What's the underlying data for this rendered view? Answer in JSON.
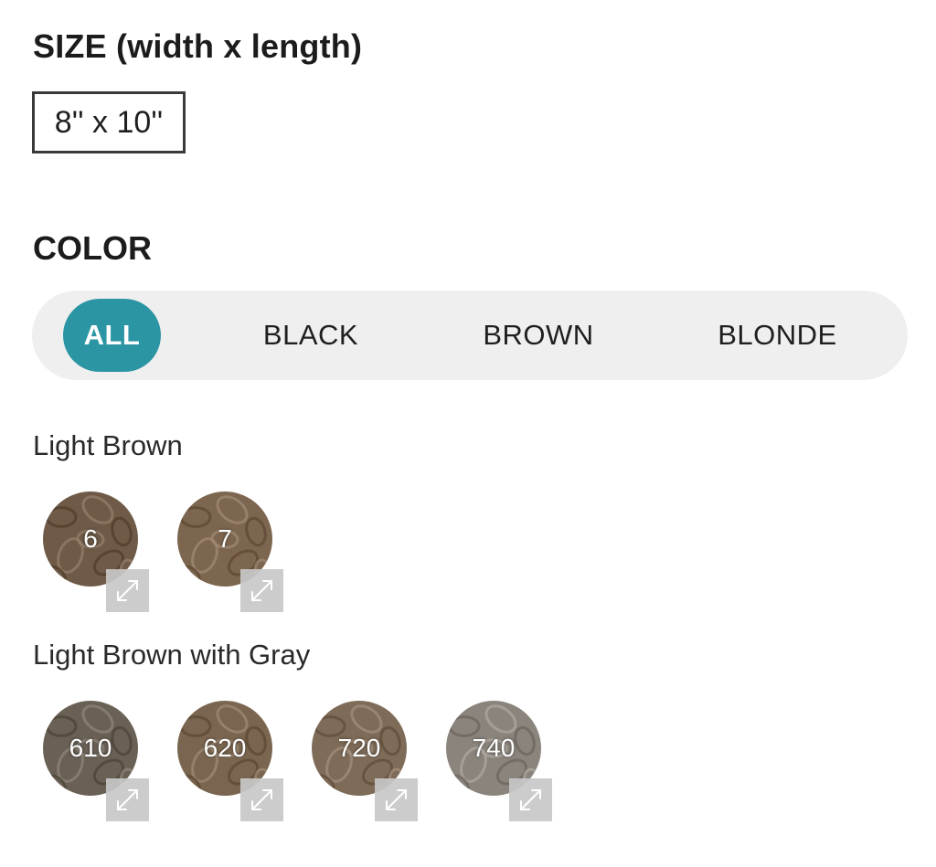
{
  "size": {
    "title": "SIZE (width x length)",
    "selected": "8'' x 10''"
  },
  "color": {
    "title": "COLOR",
    "filters": [
      "ALL",
      "BLACK",
      "BROWN",
      "BLONDE"
    ],
    "active_filter": "ALL",
    "accent": "#2b95a3"
  },
  "groups": [
    {
      "title": "Light Brown",
      "swatches": [
        {
          "label": "6",
          "color": "#6e5a46"
        },
        {
          "label": "7",
          "color": "#7d6650"
        }
      ]
    },
    {
      "title": "Light Brown with Gray",
      "swatches": [
        {
          "label": "610",
          "color": "#6a6156"
        },
        {
          "label": "620",
          "color": "#7a6650"
        },
        {
          "label": "720",
          "color": "#7e6b58"
        },
        {
          "label": "740",
          "color": "#8a847c"
        }
      ]
    }
  ]
}
